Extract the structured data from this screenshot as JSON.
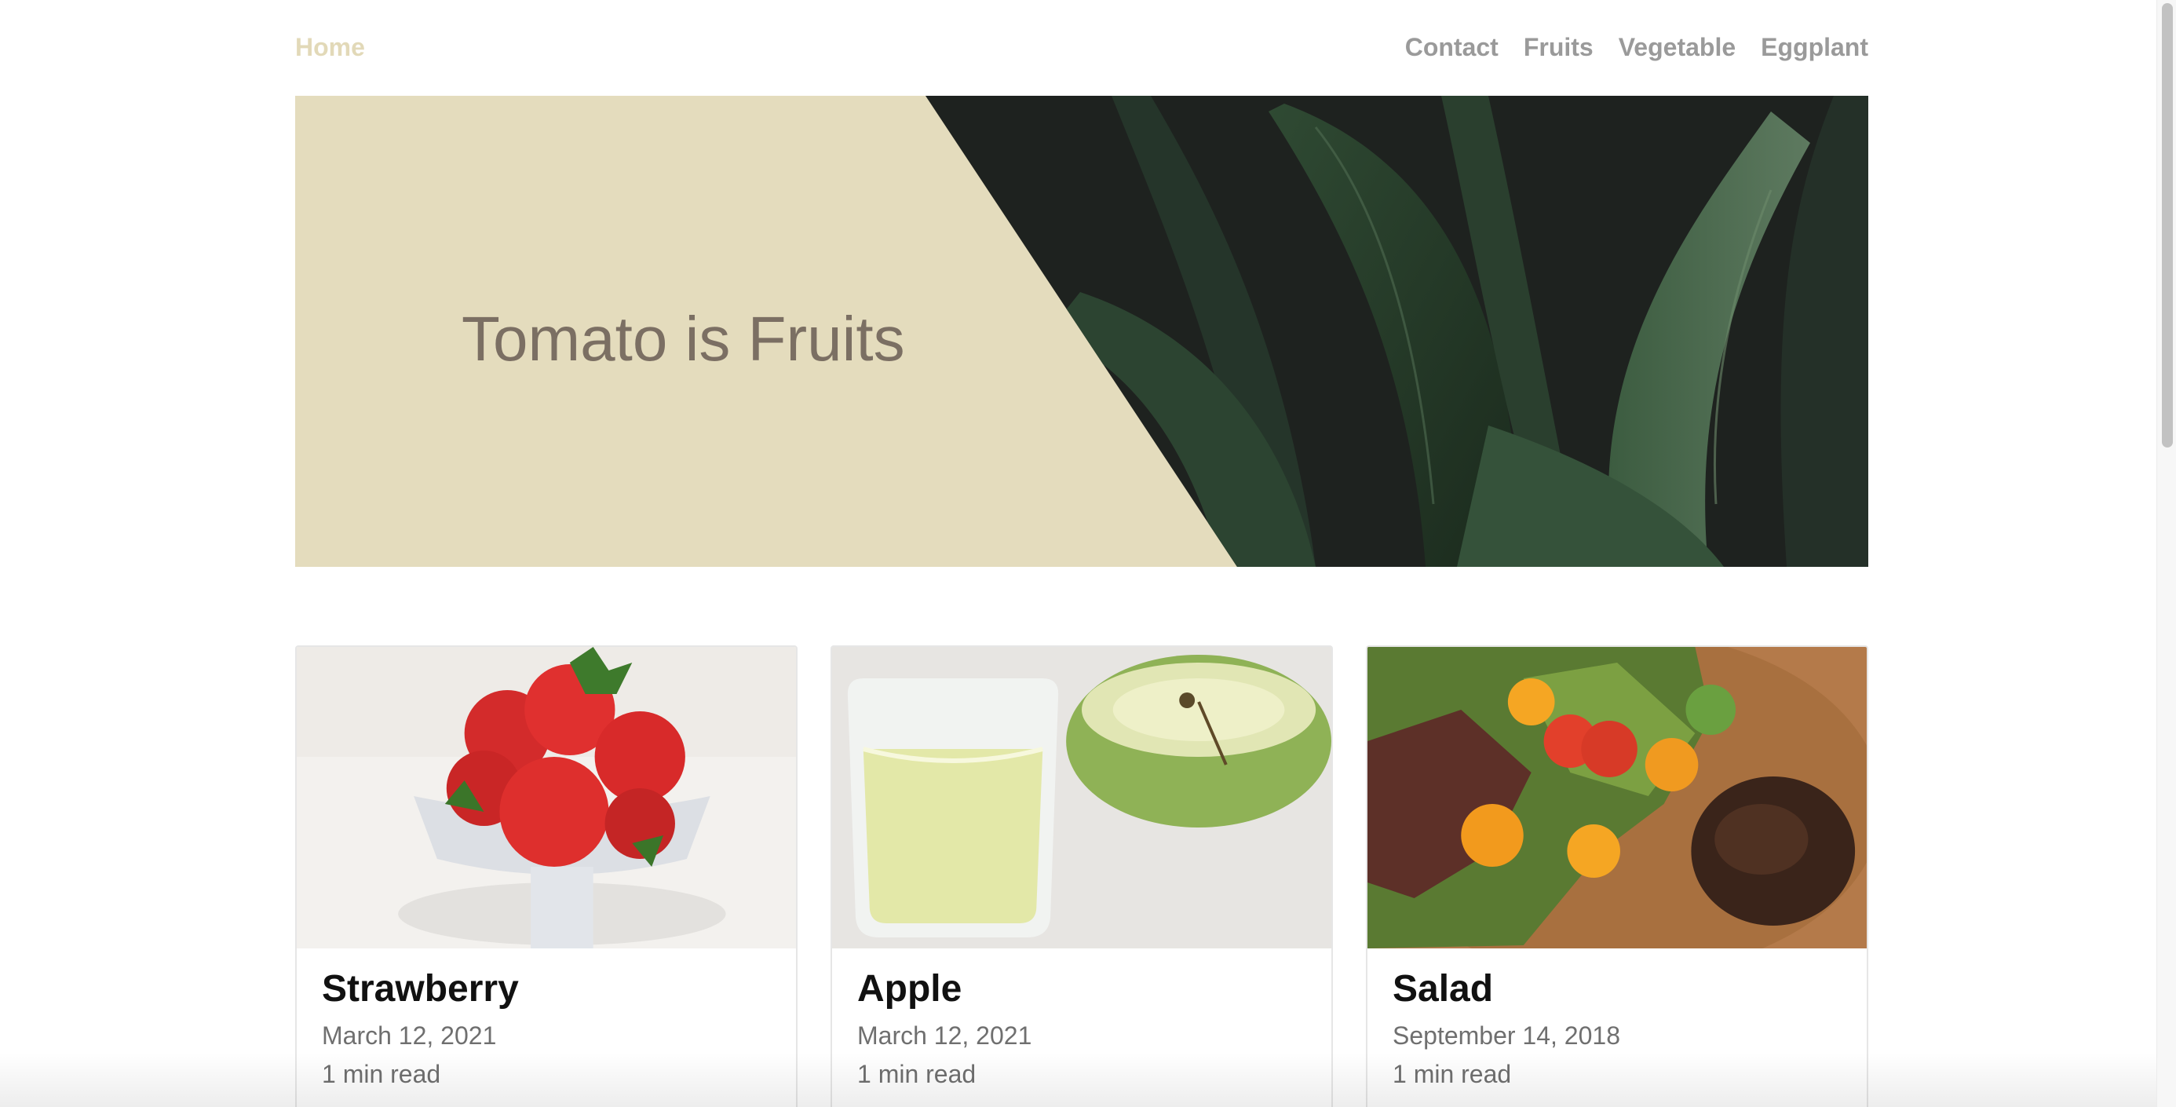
{
  "nav": {
    "home_label": "Home",
    "links": [
      {
        "label": "Contact"
      },
      {
        "label": "Fruits"
      },
      {
        "label": "Vegetable"
      },
      {
        "label": "Eggplant"
      }
    ]
  },
  "hero": {
    "title": "Tomato is Fruits",
    "background_color": "#e4dcbd",
    "image_icon": "leaves-photo"
  },
  "cards": [
    {
      "title": "Strawberry",
      "date": "March 12, 2021",
      "read_time": "1 min read",
      "image_icon": "strawberries-photo"
    },
    {
      "title": "Apple",
      "date": "March 12, 2021",
      "read_time": "1 min read",
      "image_icon": "apple-juice-photo"
    },
    {
      "title": "Salad",
      "date": "September 14, 2018",
      "read_time": "1 min read",
      "image_icon": "salad-photo"
    }
  ],
  "colors": {
    "home_accent": "#e2d9b8",
    "nav_link": "#9a9a9a",
    "hero_title": "#7b6f63"
  }
}
